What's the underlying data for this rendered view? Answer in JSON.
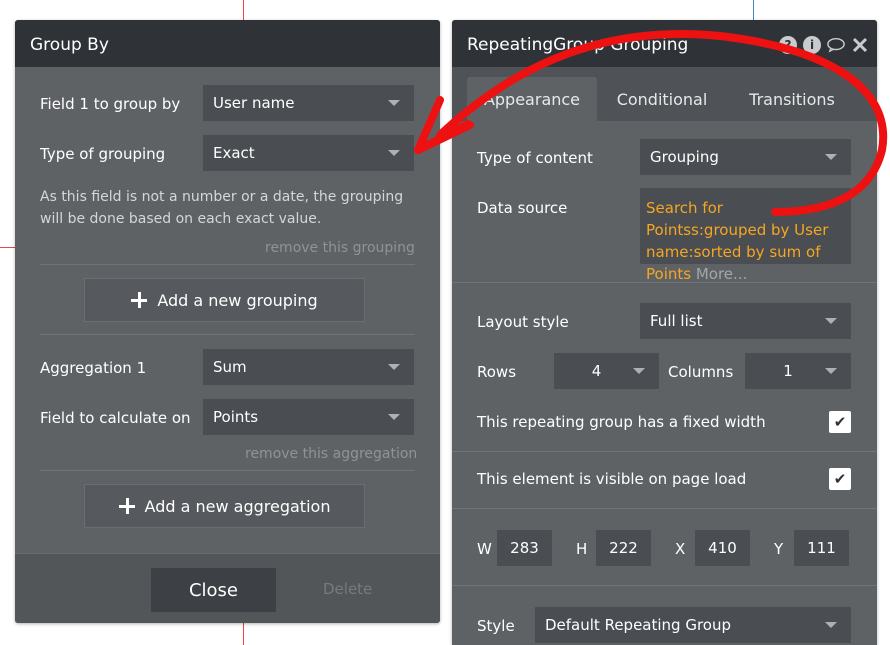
{
  "left_panel": {
    "title": "Group By",
    "field1_label": "Field 1 to group by",
    "field1_value": "User name",
    "grouping_type_label": "Type of grouping",
    "grouping_type_value": "Exact",
    "note": "As this field is not a number or a date, the grouping will be done based on each exact value.",
    "remove_grouping": "remove this grouping",
    "add_grouping": "Add a new grouping",
    "aggregation_label": "Aggregation 1",
    "aggregation_value": "Sum",
    "calc_field_label": "Field to calculate on",
    "calc_field_value": "Points",
    "remove_aggregation": "remove this aggregation",
    "add_aggregation": "Add a new aggregation",
    "close": "Close",
    "delete": "Delete"
  },
  "right_panel": {
    "title": "RepeatingGroup Grouping",
    "tabs": [
      "Appearance",
      "Conditional",
      "Transitions"
    ],
    "content_type_label": "Type of content",
    "content_type_value": "Grouping",
    "data_source_label": "Data source",
    "data_source_expr": "Search for Pointss:grouped by User name:sorted by sum of Points",
    "data_source_more": "More...",
    "layout_label": "Layout style",
    "layout_value": "Full list",
    "rows_label": "Rows",
    "rows_value": "4",
    "columns_label": "Columns",
    "columns_value": "1",
    "fixed_width_label": "This repeating group has a fixed width",
    "visible_label": "This element is visible on page load",
    "check_glyph": "✔",
    "w_label": "W",
    "w_value": "283",
    "h_label": "H",
    "h_value": "222",
    "x_label": "X",
    "x_value": "410",
    "y_label": "Y",
    "y_value": "111",
    "style_label": "Style",
    "style_value": "Default Repeating Group"
  },
  "colors": {
    "panel": "#5f6265",
    "titlebar": "#2f3337",
    "accent_orange": "#f5a623",
    "annotation_red": "#ee1111"
  },
  "icons": [
    "question-circle-icon",
    "info-circle-icon",
    "comment-icon",
    "close-icon",
    "chevron-down-icon",
    "plus-icon",
    "check-icon"
  ]
}
